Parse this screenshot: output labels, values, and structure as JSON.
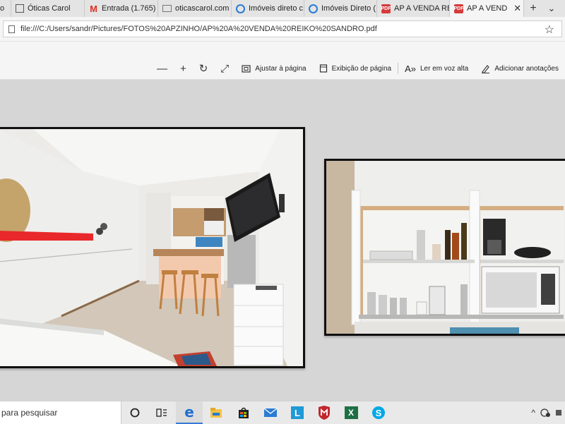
{
  "tabs": [
    {
      "label": "o",
      "icon": "none",
      "active": false
    },
    {
      "label": "Óticas Carol",
      "icon": "page-icon",
      "active": false
    },
    {
      "label": "Entrada (1.765)",
      "icon": "gmail-icon",
      "active": false
    },
    {
      "label": "oticascarol.com",
      "icon": "envelope-icon",
      "active": false
    },
    {
      "label": "Imóveis direto c",
      "icon": "ie-icon",
      "active": false
    },
    {
      "label": "Imóveis Direto (",
      "icon": "ie-icon",
      "active": false
    },
    {
      "label": "AP A VENDA RE",
      "icon": "pdf-icon",
      "active": false
    },
    {
      "label": "AP A VEND",
      "icon": "pdf-icon",
      "active": true
    }
  ],
  "tab_controls": {
    "close": "✕",
    "new_tab": "+",
    "tab_list": "⌄"
  },
  "address": {
    "url": "file:///C:/Users/sandr/Pictures/FOTOS%20APZINHO/AP%20A%20VENDA%20REIKO%20SANDRO.pdf",
    "favorite": "☆"
  },
  "pdf_toolbar": {
    "zoom_out": "—",
    "zoom_in": "+",
    "rotate": "↻",
    "fullscreen": "⤢",
    "fit_page": "Ajustar à página",
    "page_view": "Exibição de página",
    "read_aloud": "Ler em voz alta",
    "add_notes": "Adicionar anotações"
  },
  "document": {
    "photos": [
      {
        "name": "living-room-photo",
        "subject": "studio living room with TV, kitchen counter and bar stools"
      },
      {
        "name": "kitchen-cabinet-photo",
        "subject": "open kitchen cabinets with microwave and coffee maker"
      }
    ]
  },
  "taskbar": {
    "search_text": "para pesquisar",
    "apps": [
      "cortana-icon",
      "task-view-icon",
      "edge-icon",
      "file-explorer-icon",
      "store-icon",
      "mail-icon",
      "l-app-icon",
      "mcafee-icon",
      "excel-icon",
      "skype-icon"
    ],
    "tray": {
      "chevron": "^"
    }
  },
  "colors": {
    "accent": "#3a7bd5",
    "pdf_red": "#d73a3a",
    "background": "#d6d6d6"
  }
}
